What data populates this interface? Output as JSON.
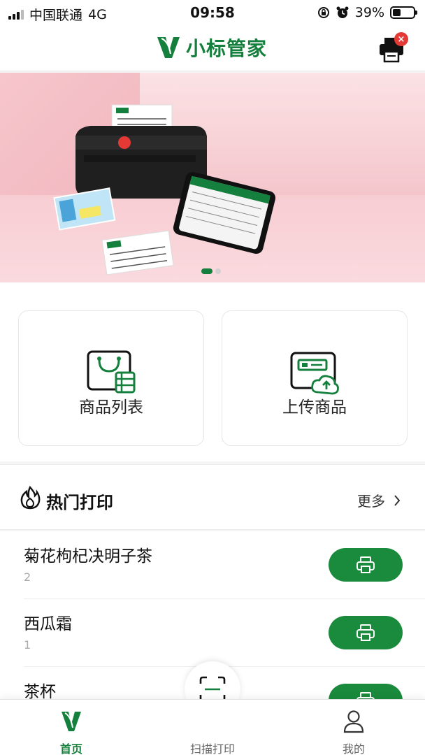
{
  "status_bar": {
    "carrier": "中国联通",
    "network": "4G",
    "time": "09:58",
    "battery": "39%",
    "battery_level": 0.39
  },
  "header": {
    "title": "小标管家",
    "printer_status": "disconnected"
  },
  "banner": {
    "slide_count": 2,
    "active_slide": 1
  },
  "actions": {
    "product_list": "商品列表",
    "upload_product": "上传商品"
  },
  "hot_print": {
    "title": "热门打印",
    "more": "更多"
  },
  "items": [
    {
      "name": "菊花枸杞决明子茶",
      "count": "2"
    },
    {
      "name": "西瓜霜",
      "count": "1"
    },
    {
      "name": "茶杯",
      "count": ""
    }
  ],
  "tabs": {
    "home": "首页",
    "scan": "扫描打印",
    "me": "我的"
  },
  "colors": {
    "brand": "#15803d",
    "button": "#1a8a3c",
    "badge": "#e53935"
  }
}
